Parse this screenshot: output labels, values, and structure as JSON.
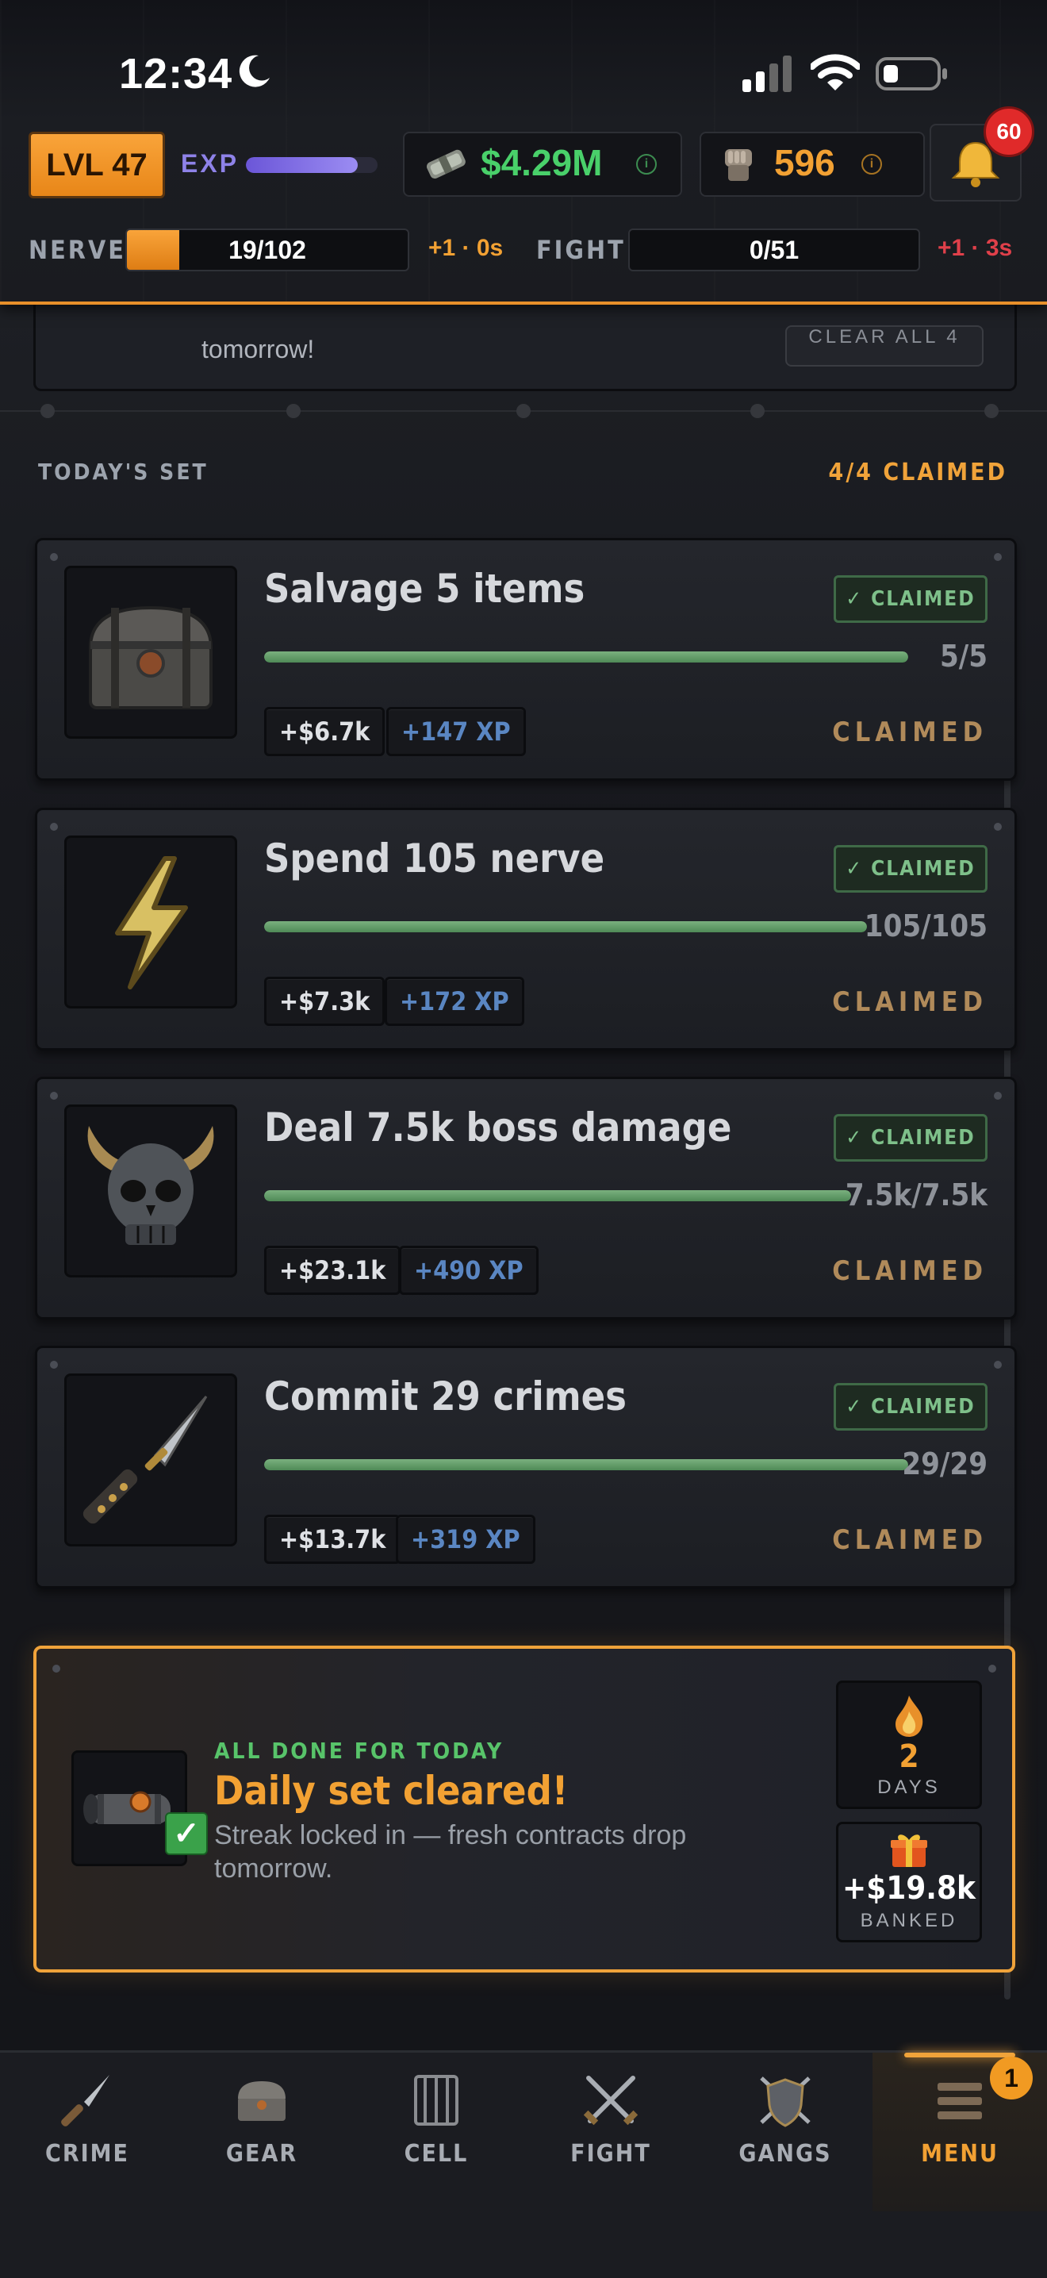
{
  "status_bar": {
    "time": "12:34"
  },
  "header": {
    "level": "LVL 47",
    "exp_label": "EXP",
    "exp_progress": 0.85,
    "cash": "$4.29M",
    "fists": "596",
    "notifications": "60",
    "nerve": {
      "label": "NERVE",
      "value": "19/102",
      "current": 19,
      "max": 102,
      "regen": "+1 · 0s"
    },
    "fight": {
      "label": "FIGHT",
      "value": "0/51",
      "current": 0,
      "max": 51,
      "regen": "+1 · 3s"
    }
  },
  "previous": {
    "text": "tomorrow!",
    "button": "CLEAR ALL 4"
  },
  "section": {
    "label": "TODAY'S SET",
    "claimed": "4/4 CLAIMED"
  },
  "contracts": [
    {
      "title": "Salvage 5 items",
      "badge": "✓ CLAIMED",
      "count": "5/5",
      "progress": 1.0,
      "cash": "+$6.7k",
      "xp": "+147 XP",
      "status": "CLAIMED",
      "icon": "chest-icon"
    },
    {
      "title": "Spend 105 nerve",
      "badge": "✓ CLAIMED",
      "count": "105/105",
      "progress": 1.0,
      "cash": "+$7.3k",
      "xp": "+172 XP",
      "status": "CLAIMED",
      "icon": "lightning-icon"
    },
    {
      "title": "Deal 7.5k boss damage",
      "badge": "✓ CLAIMED",
      "count": "7.5k/7.5k",
      "progress": 1.0,
      "cash": "+$23.1k",
      "xp": "+490 XP",
      "status": "CLAIMED",
      "icon": "skull-icon"
    },
    {
      "title": "Commit 29 crimes",
      "badge": "✓ CLAIMED",
      "count": "29/29",
      "progress": 1.0,
      "cash": "+$13.7k",
      "xp": "+319 XP",
      "status": "CLAIMED",
      "icon": "knife-icon"
    }
  ],
  "done": {
    "kicker": "ALL DONE FOR TODAY",
    "title": "Daily set cleared!",
    "subtitle": "Streak locked in — fresh contracts drop tomorrow.",
    "streak_value": "2",
    "streak_label": "DAYS",
    "banked_value": "+$19.8k",
    "banked_label": "BANKED"
  },
  "nav": [
    {
      "label": "CRIME",
      "icon": "knife-icon"
    },
    {
      "label": "GEAR",
      "icon": "chest-icon"
    },
    {
      "label": "CELL",
      "icon": "cell-icon"
    },
    {
      "label": "FIGHT",
      "icon": "crossed-swords-icon"
    },
    {
      "label": "GANGS",
      "icon": "shield-icon"
    },
    {
      "label": "MENU",
      "icon": "menu-icon",
      "active": true,
      "badge": "1"
    }
  ],
  "colors": {
    "accent": "#f0a33a",
    "cash": "#49d06a",
    "claimed": "#7ec08a",
    "xp": "#5a86c2"
  }
}
